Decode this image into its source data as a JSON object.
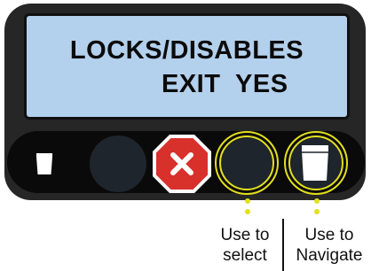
{
  "display": {
    "line1": "LOCKS/DISABLES",
    "line2": "EXIT  YES",
    "background_color": "#b3d0ec"
  },
  "buttons": [
    {
      "name": "small-cup",
      "icon": "small-cup-icon"
    },
    {
      "name": "blank",
      "icon": ""
    },
    {
      "name": "cancel",
      "icon": "stop-x-icon",
      "color": "#d8312c"
    },
    {
      "name": "select",
      "icon": ""
    },
    {
      "name": "navigate",
      "icon": "large-cup-icon"
    }
  ],
  "highlight_color": "#e2df1e",
  "labels": {
    "select_line1": "Use to",
    "select_line2": "select",
    "navigate_line1": "Use to",
    "navigate_line2": "Navigate"
  }
}
